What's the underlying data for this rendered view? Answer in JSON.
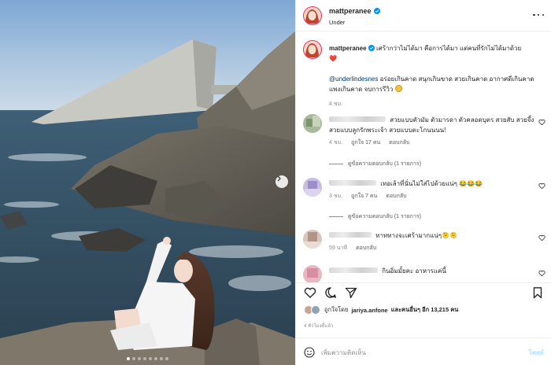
{
  "post": {
    "username": "mattperanee",
    "location": "Under"
  },
  "caption": {
    "username": "mattperanee",
    "line1": "เศร้ากว่าไม่ได้มา คือการได้มา แต่คนที่รักไม่ได้มาด้วย",
    "heart": "❤️",
    "mention": "@underlindesnes",
    "line2": "อร่อยเกินคาด สนุกเกินขาด สวยเกินคาด อากาศดีเกินคาด แพงเกินคาด จบการรีวิว",
    "time": "4 ชม."
  },
  "comments": [
    {
      "text": "สวยแบบตัวมัม ตัวมารดา ตัวคลอดบุตร สวยสับ สวยจึ้ง สวยแบบลูกรักพระเจ้า สวยแบบตะโกนนนน!",
      "time": "4 ชม.",
      "likes": "ถูกใจ 17 คน",
      "reply": "ตอบกลับ",
      "view_replies": "ดูข้อความตอบกลับ (1 รายการ)"
    },
    {
      "text": "เทอเล้าที่นั่นไม่ใส่ไปด้วยแน่ๆ",
      "emoji": "😂😂😂",
      "time": "3 ชม.",
      "likes": "ถูกใจ 7 คน",
      "reply": "ตอบกลับ",
      "view_replies": "ดูข้อความตอบกลับ (1 รายการ)"
    },
    {
      "text": "ทาททางจะเศร้ามากแน่ๆ🫠🫠",
      "time": "59 นาที",
      "reply": "ตอบกลับ"
    },
    {
      "text": "กินอิ่มมั้ยคะ อาหารแค่นี้"
    }
  ],
  "actions": {
    "liked_by_prefix": "ถูกใจโดย",
    "liked_by_user": "jariya.anfone",
    "liked_by_suffix": "และคนอื่นๆ อีก 13,215 คน",
    "post_time": "4 ชั่วโมงที่แล้ว"
  },
  "composer": {
    "placeholder": "เพิ่มความคิดเห็น",
    "post_label": "โพสต์"
  },
  "colors": {
    "accent_link": "#00376b",
    "post_button_disabled": "#b2dffc",
    "heart_red": "#ed4956",
    "story_ring": "#e1306c"
  },
  "icons": [
    "verified-badge-icon",
    "more-options-icon",
    "heart-icon",
    "comment-icon",
    "share-icon",
    "bookmark-icon",
    "emoji-icon",
    "chevron-right-icon"
  ]
}
